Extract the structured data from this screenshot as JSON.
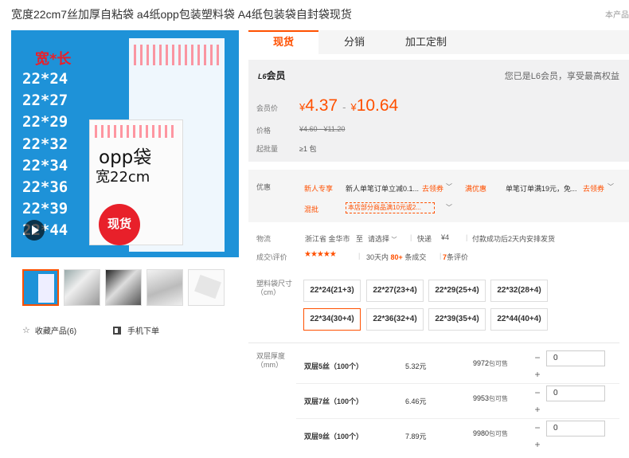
{
  "title": "宽度22cm7丝加厚自粘袋 a4纸opp包装塑料袋 A4纸包装袋自封袋现货",
  "product_no": "本产品",
  "main_image": {
    "heading": "宽*长",
    "sizes": [
      "22*24",
      "22*27",
      "22*29",
      "22*32",
      "22*34",
      "22*36",
      "22*39",
      "22*44"
    ],
    "bag_text": "opp袋",
    "width_text": "宽22cm",
    "badge": "现货"
  },
  "thumbnails": [
    "thumb-1",
    "thumb-2",
    "thumb-3",
    "thumb-4",
    "thumb-5"
  ],
  "actions": {
    "favorite": "收藏产品(6)",
    "mobile_order": "手机下单"
  },
  "tabs": [
    "现货",
    "分销",
    "加工定制"
  ],
  "member": {
    "level": "L6",
    "label": "会员",
    "note": "您已是L6会员，享受最高权益",
    "price_label": "会员价",
    "price_low": "4.37",
    "price_high": "10.64",
    "currency": "¥",
    "orig_label": "价格",
    "orig_price": "¥4.60 - ¥11.20",
    "moq_label": "起批量",
    "moq_value": "≥1 包"
  },
  "promotions": {
    "label": "优惠",
    "new_user_tag": "新人专享",
    "new_user_text": "新人单笔订单立减0.1...",
    "get_coupon": "去领券",
    "full_discount_tag": "满优惠",
    "full_discount_text": "单笔订单满19元，免...",
    "mix_label": "混批",
    "mix_text": "本店部分商品满10元或2..."
  },
  "logistics": {
    "label": "物流",
    "origin": "浙江省 金华市",
    "to": "至",
    "select": "请选择",
    "ship_label": "快递",
    "ship_price": "¥4",
    "pay_note": "付款成功后2天内安排发货"
  },
  "rating": {
    "label": "成交\\评价",
    "stars": "★★★★★",
    "deals_prefix": "30天内",
    "deals_num": "80+",
    "deals_suffix": "条成交",
    "reviews_num": "7",
    "reviews_suffix": "条评价"
  },
  "spec": {
    "label_line1": "塑料袋尺寸",
    "label_line2": "（cm）",
    "options": [
      "22*24(21+3)",
      "22*27(23+4)",
      "22*29(25+4)",
      "22*32(28+4)",
      "22*34(30+4)",
      "22*36(32+4)",
      "22*39(35+4)",
      "22*44(40+4)"
    ],
    "selected": "22*34(30+4)"
  },
  "thickness": {
    "label_line1": "双层厚度",
    "label_line2": "（mm）",
    "rows": [
      {
        "name": "双层5丝（100个）",
        "price": "5.32元",
        "stock": "9972",
        "stock_unit": "包可售",
        "qty": "0"
      },
      {
        "name": "双层7丝（100个）",
        "price": "6.46元",
        "stock": "9953",
        "stock_unit": "包可售",
        "qty": "0"
      },
      {
        "name": "双层9丝（100个）",
        "price": "7.89元",
        "stock": "9980",
        "stock_unit": "包可售",
        "qty": "0"
      }
    ]
  },
  "colors": {
    "accent": "#ff5000",
    "image_bg": "#1e92d8",
    "badge_red": "#e8202a"
  }
}
